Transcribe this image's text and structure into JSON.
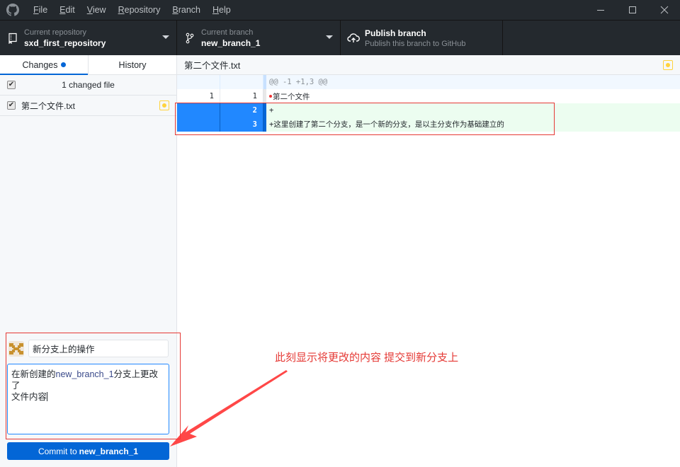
{
  "window": {
    "menu": [
      "File",
      "Edit",
      "View",
      "Repository",
      "Branch",
      "Help"
    ],
    "menu_mnemonics": [
      "F",
      "E",
      "V",
      "R",
      "B",
      "H"
    ],
    "controls": [
      "minimize",
      "maximize",
      "close"
    ]
  },
  "toolbar": {
    "repository": {
      "label": "Current repository",
      "value": "sxd_first_repository"
    },
    "branch": {
      "label": "Current branch",
      "value": "new_branch_1"
    },
    "publish": {
      "label": "Publish branch",
      "sublabel": "Publish this branch to GitHub"
    }
  },
  "sidebar": {
    "tabs": [
      {
        "label": "Changes",
        "active": true,
        "has_indicator": true
      },
      {
        "label": "History",
        "active": false
      }
    ],
    "changes_header": "1 changed file",
    "files": [
      {
        "name": "第二个文件.txt",
        "checked": true,
        "status": "modified"
      }
    ]
  },
  "commit": {
    "summary": "新分支上的操作",
    "description_line1_prefix": "在新创建的",
    "description_line1_branch": "new_branch_1",
    "description_line1_suffix": "分支上更改了",
    "description_line2": "文件内容",
    "button_prefix": "Commit to",
    "button_branch": "new_branch_1"
  },
  "diff": {
    "file_name": "第二个文件.txt",
    "hunk_header": "@@ -1 +1,3 @@",
    "lines": [
      {
        "type": "context",
        "old": "1",
        "new": "1",
        "text": "第二个文件"
      },
      {
        "type": "add",
        "old": "",
        "new": "2",
        "text": "+"
      },
      {
        "type": "add",
        "old": "",
        "new": "3",
        "text": "+这里创建了第二个分支，是一个新的分支，是以主分支作为基础建立的"
      }
    ]
  },
  "annotation": {
    "text": "此刻显示将更改的内容  提交到新分支上",
    "color": "#e53935"
  },
  "colors": {
    "accent": "#0366d6",
    "toolbar_bg": "#24292e",
    "modified": "#ffd33d",
    "added_bg": "#ecfdf0"
  }
}
